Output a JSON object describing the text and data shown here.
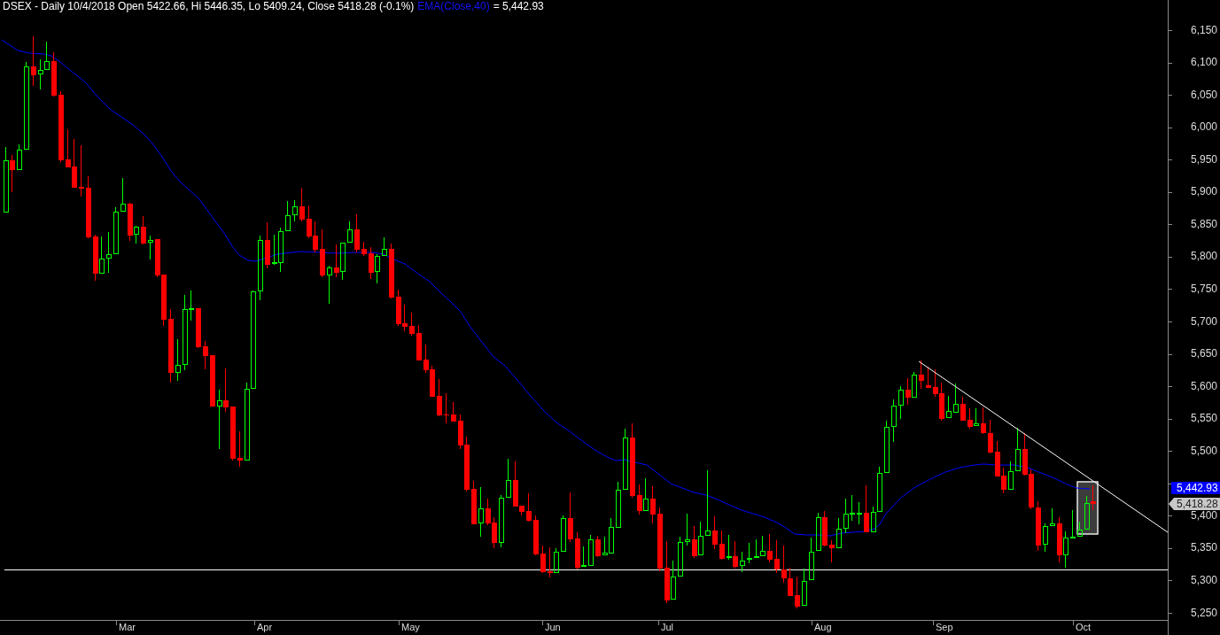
{
  "header": {
    "quote": "DSEX - Daily 10/4/2018 Open 5422.66, Hi 5446.35, Lo 5409.24, Close 5418.28 (-0.1%)",
    "indicator": "EMA(Close,40)",
    "indicator_value": "= 5,442.93"
  },
  "price_axis": {
    "labels": [
      "6,150",
      "6,100",
      "6,050",
      "6,000",
      "5,950",
      "5,900",
      "5,850",
      "5,800",
      "5,750",
      "5,700",
      "5,650",
      "5,600",
      "5,550",
      "5,500",
      "5,400",
      "5,350",
      "5,300",
      "5,250"
    ]
  },
  "price_tags": [
    {
      "kind": "indicator",
      "text": "5,442.93"
    },
    {
      "kind": "last",
      "text": "5,418.28"
    }
  ],
  "time_axis": {
    "labels": [
      "Mar",
      "Apr",
      "May",
      "Jun",
      "Jul",
      "Aug",
      "Sep",
      "Oct"
    ]
  }
}
